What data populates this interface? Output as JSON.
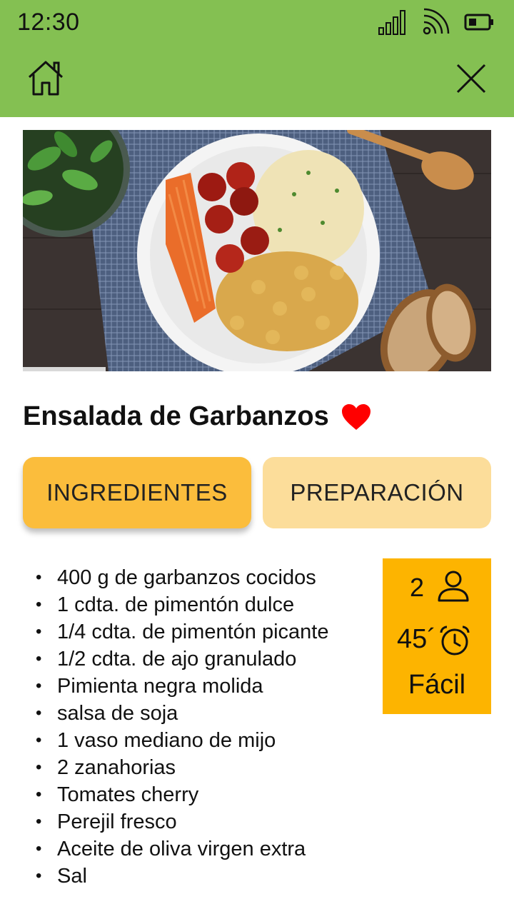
{
  "status_bar": {
    "time": "12:30",
    "icons": [
      "signal-icon",
      "wifi-icon",
      "battery-icon"
    ]
  },
  "app_bar": {
    "home_icon": "home-icon",
    "close_icon": "close-icon",
    "background_color": "#84c052"
  },
  "recipe": {
    "title": "Ensalada de Garbanzos",
    "favorite_icon": "heart-icon",
    "favorite_color": "#ff0000"
  },
  "tabs": [
    {
      "label": "INGREDIENTES",
      "active": true,
      "color": "#fbbd3c"
    },
    {
      "label": "PREPARACIÓN",
      "active": false,
      "color": "#fcdd9a"
    }
  ],
  "ingredients": [
    "400 g de garbanzos cocidos",
    "1 cdta. de pimentón dulce",
    "1/4 cdta. de pimentón picante",
    "1/2 cdta. de ajo granulado",
    "Pimienta negra molida",
    "salsa de soja",
    "1 vaso mediano de mijo",
    "2 zanahorias",
    "Tomates cherry",
    "Perejil fresco",
    "Aceite de oliva virgen extra",
    "Sal"
  ],
  "info": {
    "servings": "2",
    "servings_icon": "person-icon",
    "time": "45´",
    "time_icon": "alarm-clock-icon",
    "difficulty": "Fácil",
    "background_color": "#fdb400"
  }
}
